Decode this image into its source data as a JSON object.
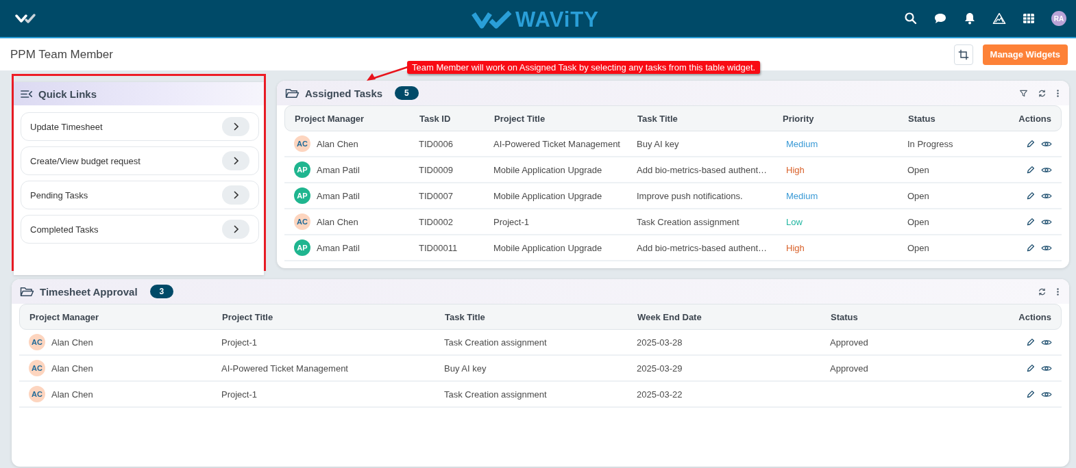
{
  "top_bar": {
    "logo_text": "WAViTY",
    "avatar": "RA"
  },
  "page": {
    "title": "PPM Team Member",
    "button": "Manage Widgets"
  },
  "annotation": {
    "text": "Team Member will work on Assigned Task by selecting any tasks from this table widget."
  },
  "quick_links": {
    "title": "Quick Links",
    "items": [
      {
        "label": "Update Timesheet"
      },
      {
        "label": "Create/View budget request"
      },
      {
        "label": "Pending Tasks"
      },
      {
        "label": "Completed Tasks"
      }
    ]
  },
  "assigned_tasks": {
    "title": "Assigned Tasks",
    "count": "5",
    "columns": [
      "Project Manager",
      "Task ID",
      "Project Title",
      "Task Title",
      "Priority",
      "Status",
      "Actions"
    ],
    "rows": [
      {
        "manager": {
          "initials": "AC",
          "name": "Alan Chen",
          "color": "#fdd5bf"
        },
        "task_id": "TID0006",
        "project_title": "AI-Powered Ticket Management",
        "task_title": "Buy AI key",
        "priority": {
          "text": "Medium",
          "color": "#3a9ad6"
        },
        "status": "In Progress"
      },
      {
        "manager": {
          "initials": "AP",
          "name": "Aman Patil",
          "color": "#1fb58f"
        },
        "task_id": "TID0009",
        "project_title": "Mobile Application Upgrade",
        "task_title": "Add bio-metrics-based authent…",
        "priority": {
          "text": "High",
          "color": "#d9622b"
        },
        "status": "Open"
      },
      {
        "manager": {
          "initials": "AP",
          "name": "Aman Patil",
          "color": "#1fb58f"
        },
        "task_id": "TID0007",
        "project_title": "Mobile Application Upgrade",
        "task_title": "Improve push notifications.",
        "priority": {
          "text": "Medium",
          "color": "#3a9ad6"
        },
        "status": "Open"
      },
      {
        "manager": {
          "initials": "AC",
          "name": "Alan Chen",
          "color": "#fdd5bf"
        },
        "task_id": "TID0002",
        "project_title": "Project-1",
        "task_title": "Task Creation assignment",
        "priority": {
          "text": "Low",
          "color": "#1fb5a0"
        },
        "status": "Open"
      },
      {
        "manager": {
          "initials": "AP",
          "name": "Aman Patil",
          "color": "#1fb58f"
        },
        "task_id": "TID00011",
        "project_title": "Mobile Application Upgrade",
        "task_title": "Add bio-metrics-based authent…",
        "priority": {
          "text": "High",
          "color": "#d9622b"
        },
        "status": "Open"
      }
    ]
  },
  "timesheet_approval": {
    "title": "Timesheet Approval",
    "count": "3",
    "columns": [
      "Project Manager",
      "Project Title",
      "Task Title",
      "Week End Date",
      "Status",
      "Actions"
    ],
    "rows": [
      {
        "manager": {
          "initials": "AC",
          "name": "Alan Chen",
          "color": "#fdd5bf"
        },
        "project_title": "Project-1",
        "task_title": "Task Creation assignment",
        "week_end_date": "2025-03-28",
        "status": "Approved"
      },
      {
        "manager": {
          "initials": "AC",
          "name": "Alan Chen",
          "color": "#fdd5bf"
        },
        "project_title": "AI-Powered Ticket Management",
        "task_title": "Buy AI key",
        "week_end_date": "2025-03-29",
        "status": "Approved"
      },
      {
        "manager": {
          "initials": "AC",
          "name": "Alan Chen",
          "color": "#fdd5bf"
        },
        "project_title": "Project-1",
        "task_title": "Task Creation assignment",
        "week_end_date": "2025-03-22"
      }
    ]
  }
}
